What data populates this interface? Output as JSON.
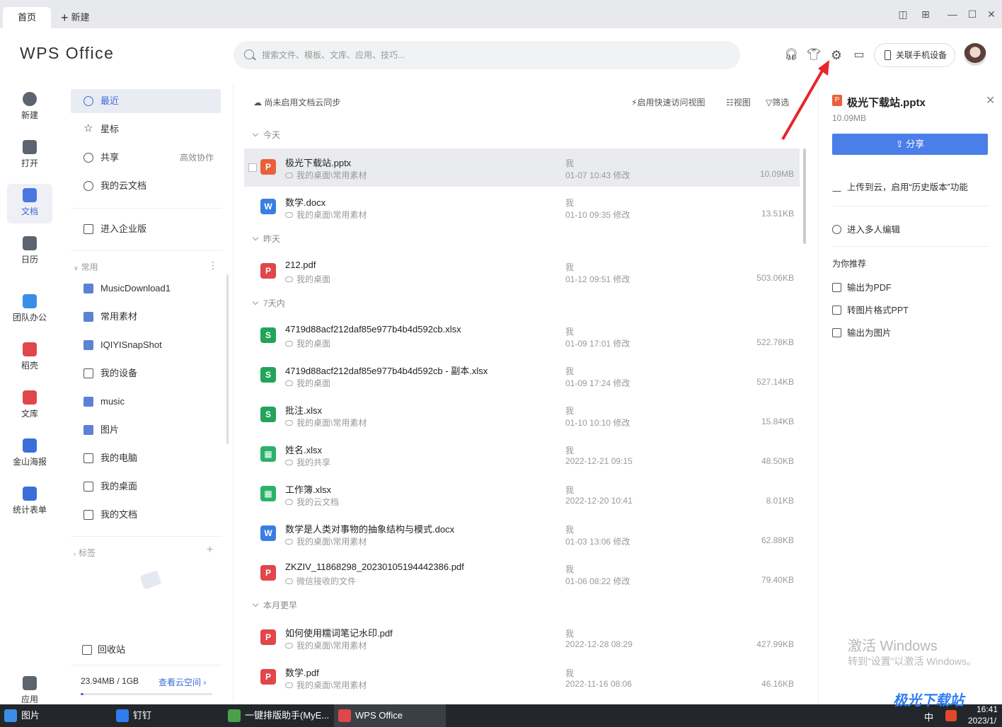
{
  "tabs": {
    "home": "首页",
    "new": "新建"
  },
  "header": {
    "logo": "WPS Office",
    "search_placeholder": "搜索文件、模板、文库、应用、技巧...",
    "link_phone": "关联手机设备"
  },
  "leftnav": [
    {
      "label": "新建",
      "icon": "plus-circle-icon"
    },
    {
      "label": "打开",
      "icon": "folder-open-icon"
    },
    {
      "label": "文档",
      "icon": "document-icon",
      "active": true
    },
    {
      "label": "日历",
      "icon": "calendar-icon"
    },
    {
      "label": "团队办公",
      "icon": "team-icon"
    },
    {
      "label": "稻壳",
      "icon": "docer-icon"
    },
    {
      "label": "文库",
      "icon": "library-icon"
    },
    {
      "label": "金山海报",
      "icon": "poster-icon"
    },
    {
      "label": "统计表单",
      "icon": "form-icon"
    },
    {
      "label": "应用",
      "icon": "apps-icon"
    }
  ],
  "sidebar": {
    "recent": "最近",
    "star": "星标",
    "share": "共享",
    "share_hint": "高效协作",
    "cloud": "我的云文档",
    "enterprise": "进入企业版",
    "common_title": "常用",
    "common": [
      "MusicDownload1",
      "常用素材",
      "IQIYISnapShot",
      "我的设备",
      "music",
      "图片",
      "我的电脑",
      "我的桌面",
      "我的文档"
    ],
    "tags_title": "标签",
    "recycle": "回收站",
    "storage": "23.94MB / 1GB",
    "storage_link": "查看云空间 ›",
    "storage_fraction": 0.023
  },
  "main": {
    "cloud_sync": "尚未启用文档云同步",
    "quick_view": "启用快速访问视图",
    "view": "视图",
    "filter": "筛选",
    "groups": {
      "today": "今天",
      "yesterday": "昨天",
      "week": "7天内",
      "month": "本月更早"
    },
    "files": [
      {
        "name": "极光下载站.pptx",
        "path": "我的桌面\\常用素材",
        "owner": "我",
        "time": "01-07 10:43 修改",
        "size": "10.09MB",
        "type": "ppt",
        "glyph": "P"
      },
      {
        "name": "数学.docx",
        "path": "我的桌面\\常用素材",
        "owner": "我",
        "time": "01-10 09:35 修改",
        "size": "13.51KB",
        "type": "doc",
        "glyph": "W"
      },
      {
        "name": "212.pdf",
        "path": "我的桌面",
        "owner": "我",
        "time": "01-12 09:51 修改",
        "size": "503.06KB",
        "type": "pdf",
        "glyph": "P"
      },
      {
        "name": "4719d88acf212daf85e977b4b4d592cb.xlsx",
        "path": "我的桌面",
        "owner": "我",
        "time": "01-09 17:01 修改",
        "size": "522.78KB",
        "type": "xls",
        "glyph": "S"
      },
      {
        "name": "4719d88acf212daf85e977b4b4d592cb - 副本.xlsx",
        "path": "我的桌面",
        "owner": "我",
        "time": "01-09 17:24 修改",
        "size": "527.14KB",
        "type": "xls",
        "glyph": "S"
      },
      {
        "name": "批注.xlsx",
        "path": "我的桌面\\常用素材",
        "owner": "我",
        "time": "01-10 10:10 修改",
        "size": "15.84KB",
        "type": "xls",
        "glyph": "S"
      },
      {
        "name": "姓名.xlsx",
        "path": "我的共享",
        "owner": "我",
        "time": "2022-12-21 09:15",
        "size": "48.50KB",
        "type": "et",
        "glyph": "▦"
      },
      {
        "name": "工作簿.xlsx",
        "path": "我的云文档",
        "owner": "我",
        "time": "2022-12-20 10:41",
        "size": "8.01KB",
        "type": "et",
        "glyph": "▦"
      },
      {
        "name": "数学是人类对事物的抽象结构与模式.docx",
        "path": "我的桌面\\常用素材",
        "owner": "我",
        "time": "01-03 13:06 修改",
        "size": "62.88KB",
        "type": "doc",
        "glyph": "W"
      },
      {
        "name": "ZKZIV_11868298_20230105194442386.pdf",
        "path": "微信接收的文件",
        "owner": "我",
        "time": "01-06 08:22 修改",
        "size": "79.40KB",
        "type": "pdf",
        "glyph": "P"
      },
      {
        "name": "如何使用糯词笔记水印.pdf",
        "path": "我的桌面\\常用素材",
        "owner": "我",
        "time": "2022-12-28 08:29",
        "size": "427.99KB",
        "type": "pdf",
        "glyph": "P"
      },
      {
        "name": "数学.pdf",
        "path": "我的桌面\\常用素材",
        "owner": "我",
        "time": "2022-11-16 08:06",
        "size": "46.16KB",
        "type": "pdf",
        "glyph": "P"
      }
    ]
  },
  "rpanel": {
    "title": "极光下载站.pptx",
    "size": "10.09MB",
    "share": "分享",
    "upload": "上传到云，启用“历史版本”功能",
    "multi_edit": "进入多人编辑",
    "recommend": "为你推荐",
    "actions": [
      "输出为PDF",
      "转图片格式PPT",
      "输出为图片"
    ]
  },
  "watermark": {
    "line1": "激活 Windows",
    "line2": "转到“设置”以激活 Windows。"
  },
  "taskbar": [
    {
      "label": "图片",
      "color": "#3a8ee6"
    },
    {
      "label": "钉钉",
      "color": "#2f7df0"
    },
    {
      "label": "一键排版助手(MyE...",
      "color": "#4aa04a"
    },
    {
      "label": "WPS Office",
      "color": "#e0464a",
      "active": true
    }
  ],
  "tray": {
    "ime": "中",
    "time": "16:41",
    "date": "2023/1/"
  },
  "brand_watermark": "极光下载站"
}
